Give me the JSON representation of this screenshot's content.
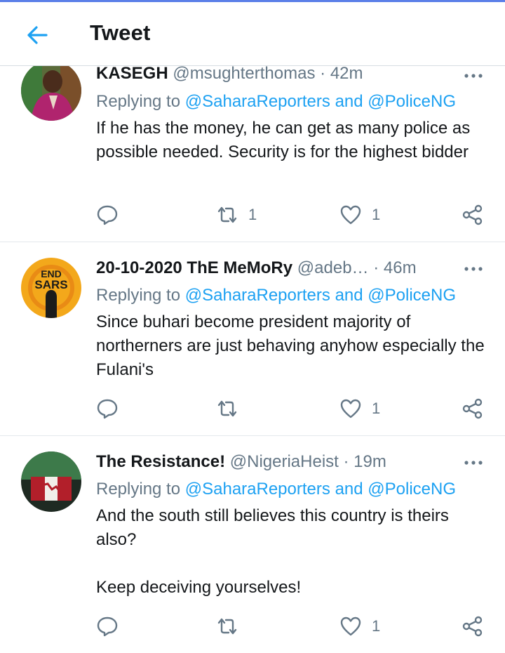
{
  "header": {
    "title": "Tweet",
    "back_icon": "arrow-left-icon",
    "accent": "#1da1f2"
  },
  "tweets": [
    {
      "name": "KASEGH",
      "handle": "@msughterthomas",
      "time": "42m",
      "reply_prefix": "Replying to",
      "reply_to_1": "@SaharaReporters",
      "reply_and": "and",
      "reply_to_2": "@PoliceNG",
      "text": "If he has the money, he can get as many police as possible needed. Security is for the highest bidder",
      "retweets": "1",
      "likes": "1"
    },
    {
      "name": "20-10-2020 ThE MeMoRy",
      "handle": "@adeb…",
      "time": "46m",
      "reply_prefix": "Replying to",
      "reply_to_1": "@SaharaReporters",
      "reply_and": "and",
      "reply_to_2": "@PoliceNG",
      "text": "Since buhari become president majority of northerners are just behaving anyhow especially the Fulani's",
      "retweets": "",
      "likes": "1"
    },
    {
      "name": "The Resistance!",
      "handle": "@NigeriaHeist",
      "time": "19m",
      "reply_prefix": "Replying to",
      "reply_to_1": "@SaharaReporters",
      "reply_and": "and",
      "reply_to_2": "@PoliceNG",
      "text": "And the south still believes this country is theirs also?\n\nKeep deceiving yourselves!",
      "retweets": "",
      "likes": "1"
    }
  ],
  "dot_separator": "·",
  "avatar_text_endsars": "END SARS"
}
